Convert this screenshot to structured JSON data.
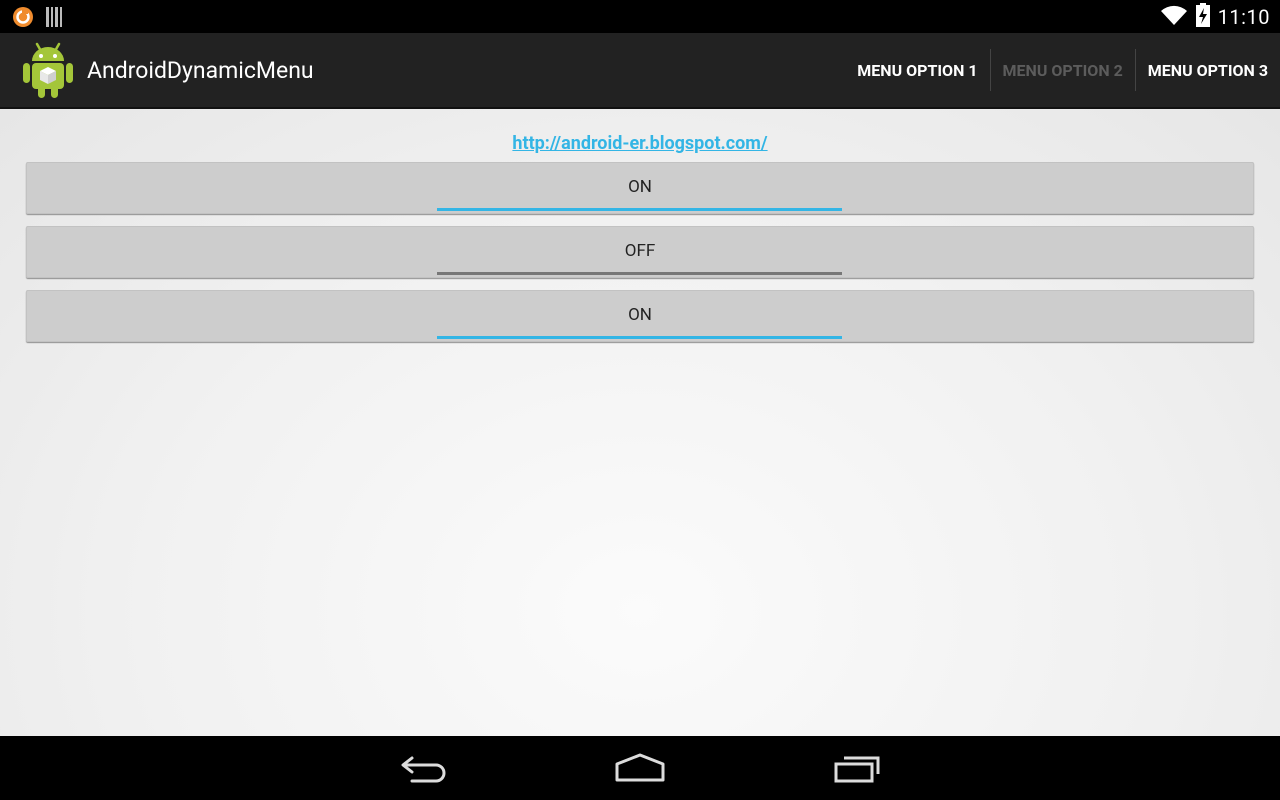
{
  "status_bar": {
    "time": "11:10",
    "icons": [
      "notification-sync-icon",
      "barcode-icon",
      "wifi-icon",
      "battery-charging-icon"
    ]
  },
  "action_bar": {
    "title": "AndroidDynamicMenu",
    "menu": [
      {
        "label": "MENU OPTION 1",
        "enabled": true
      },
      {
        "label": "MENU OPTION 2",
        "enabled": false
      },
      {
        "label": "MENU OPTION 3",
        "enabled": true
      }
    ]
  },
  "content": {
    "link": "http://android-er.blogspot.com/",
    "toggles": [
      {
        "label": "ON",
        "checked": true
      },
      {
        "label": "OFF",
        "checked": false
      },
      {
        "label": "ON",
        "checked": true
      }
    ]
  },
  "nav_bar": {
    "buttons": [
      "back-icon",
      "home-icon",
      "recents-icon"
    ]
  },
  "colors": {
    "accent": "#33b5e5",
    "action_bar": "#222222",
    "toggle_off_bar": "#777777"
  }
}
